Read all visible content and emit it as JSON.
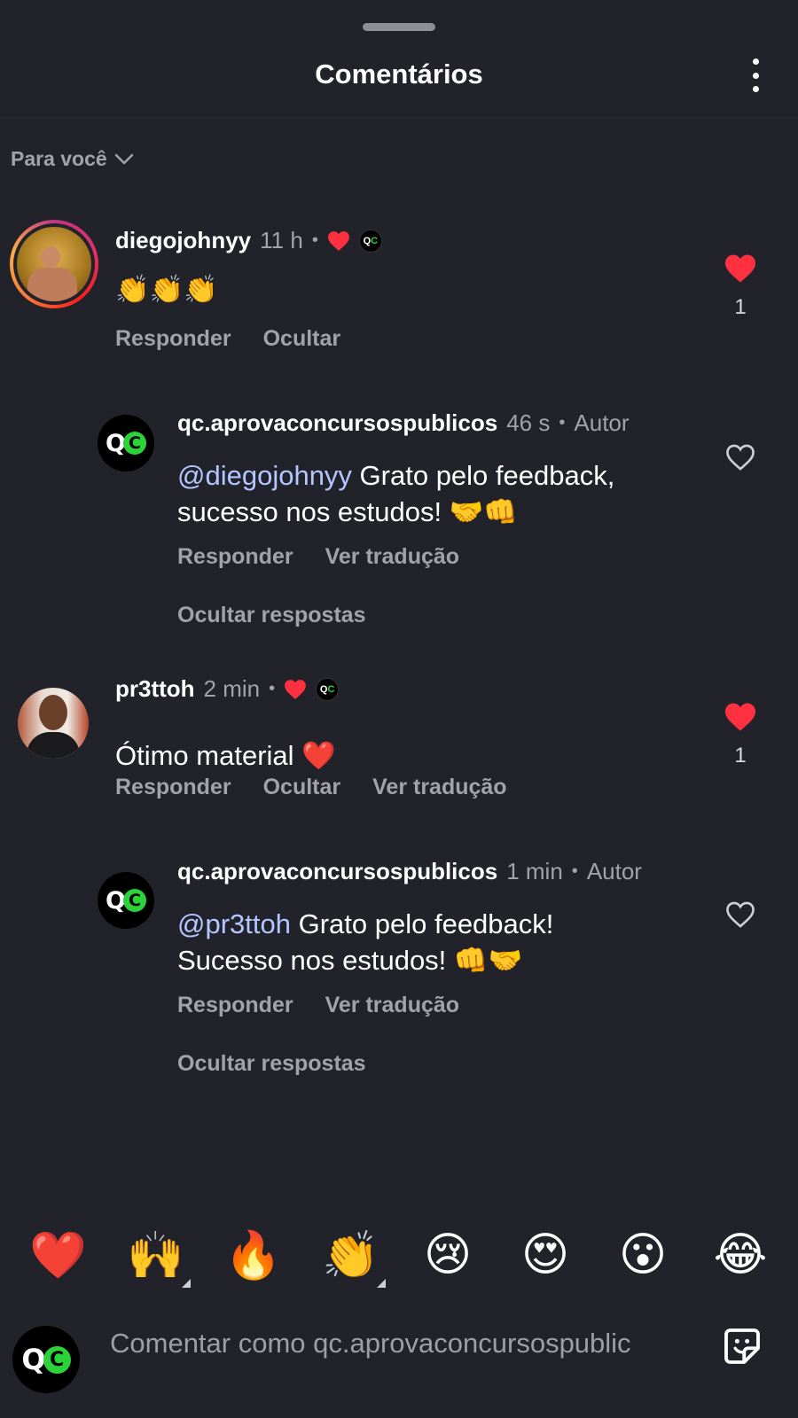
{
  "header": {
    "title": "Comentários"
  },
  "sort": {
    "label": "Para você"
  },
  "comments": [
    {
      "username": "diegojohnyy",
      "time": "11 h",
      "text": "👏👏👏",
      "actions": [
        "Responder",
        "Ocultar"
      ],
      "like_count": "1",
      "liked": true,
      "replies": [
        {
          "username": "qc.aprovaconcursospublicos",
          "time": "46 s",
          "author_tag": "Autor",
          "mention": "@diegojohnyy",
          "text_line1": " Grato pelo feedback,",
          "text_line2": "sucesso nos estudos! 🤝👊",
          "actions": [
            "Responder",
            "Ver tradução"
          ],
          "hide_replies": "Ocultar respostas"
        }
      ]
    },
    {
      "username": "pr3ttoh",
      "time": "2 min",
      "text": "Ótimo material ❤️",
      "actions": [
        "Responder",
        "Ocultar",
        "Ver tradução"
      ],
      "like_count": "1",
      "liked": true,
      "replies": [
        {
          "username": "qc.aprovaconcursospublicos",
          "time": "1 min",
          "author_tag": "Autor",
          "mention": "@pr3ttoh",
          "text_line1": " Grato pelo feedback!",
          "text_line2": "Sucesso nos estudos! 👊🤝",
          "actions": [
            "Responder",
            "Ver tradução"
          ],
          "hide_replies": "Ocultar respostas"
        }
      ]
    }
  ],
  "quick_reactions": [
    "❤️",
    "🙌",
    "🔥",
    "👏",
    "😢",
    "😍",
    "😮",
    "😂"
  ],
  "composer": {
    "placeholder": "Comentar como qc.aprovaconcursospublic"
  },
  "colors": {
    "background": "#22232a",
    "like_red": "#ff3040",
    "mention_blue": "#b3c6ff",
    "qc_green": "#2bd23a"
  },
  "icons": [
    "chevron-down-icon",
    "more-vertical-icon",
    "heart-icon",
    "heart-outline-icon",
    "sticker-icon"
  ]
}
